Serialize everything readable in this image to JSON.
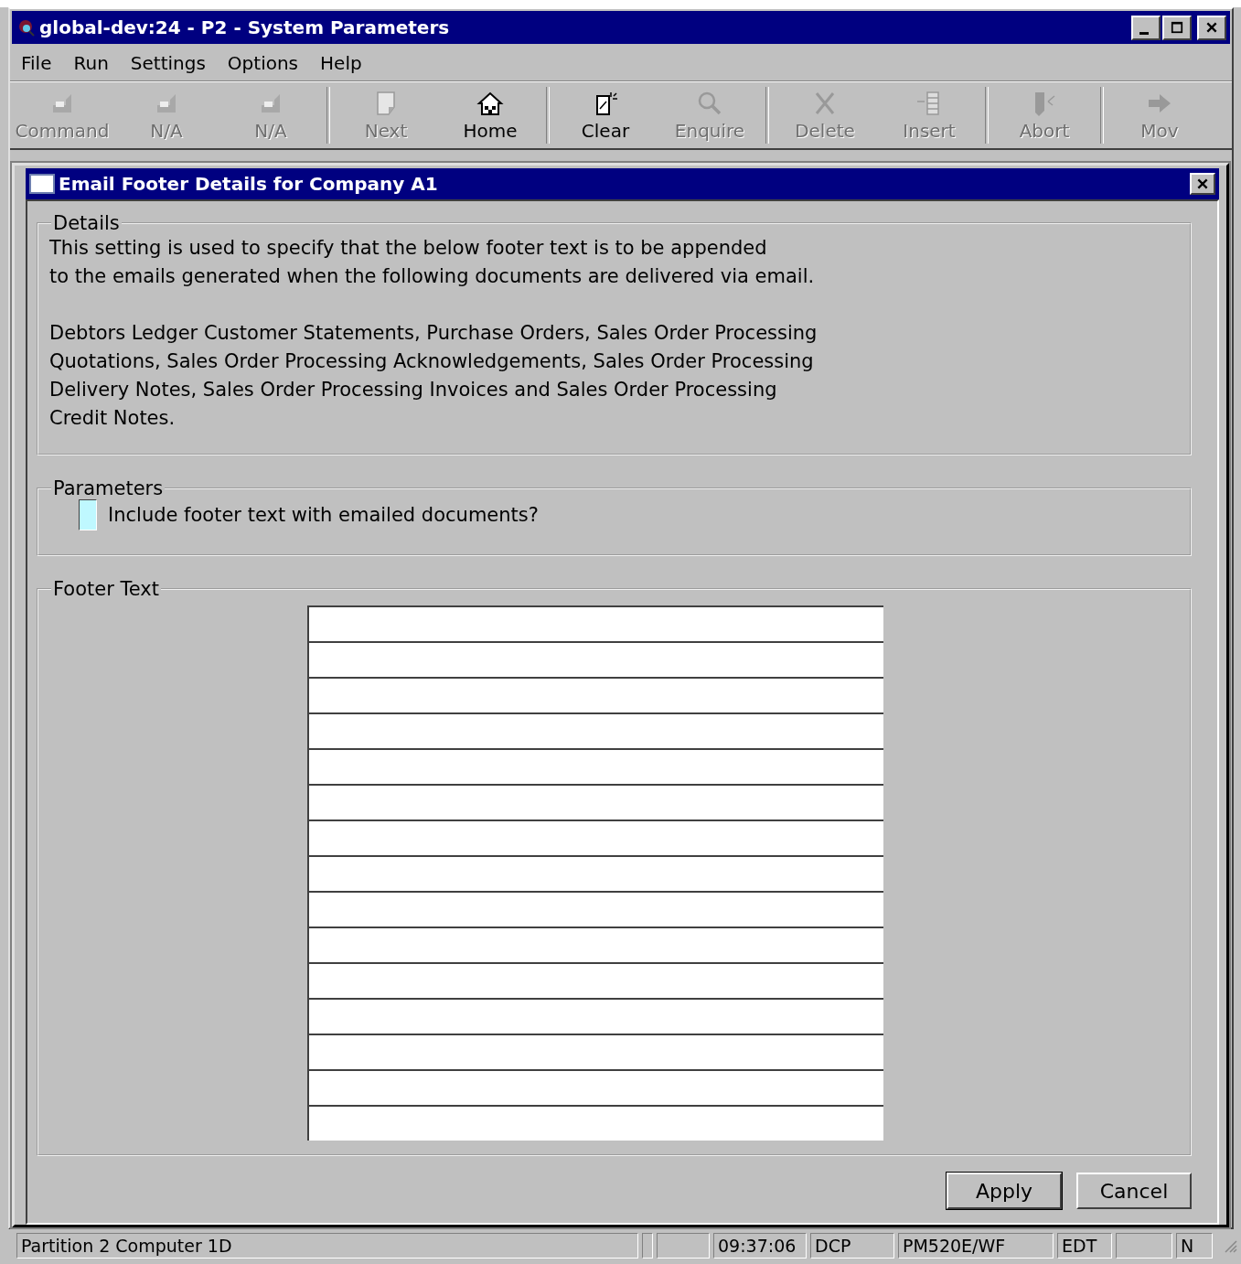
{
  "window": {
    "title": "global-dev:24 - P2 - System Parameters"
  },
  "menu": [
    {
      "label": "File"
    },
    {
      "label": "Run"
    },
    {
      "label": "Settings"
    },
    {
      "label": "Options"
    },
    {
      "label": "Help"
    }
  ],
  "toolbar": [
    [
      {
        "label": "Command",
        "kind": "f1",
        "disabled": true
      },
      {
        "label": "N/A",
        "kind": "f2",
        "disabled": true
      },
      {
        "label": "N/A",
        "kind": "f3",
        "disabled": true
      }
    ],
    [
      {
        "label": "Next",
        "kind": "next",
        "disabled": true
      },
      {
        "label": "Home",
        "kind": "home",
        "disabled": false
      }
    ],
    [
      {
        "label": "Clear",
        "kind": "clear",
        "disabled": false
      },
      {
        "label": "Enquire",
        "kind": "enquire",
        "disabled": true
      }
    ],
    [
      {
        "label": "Delete",
        "kind": "delete",
        "disabled": true
      },
      {
        "label": "Insert",
        "kind": "insert",
        "disabled": true
      }
    ],
    [
      {
        "label": "Abort",
        "kind": "abort",
        "disabled": true
      }
    ],
    [
      {
        "label": "Mov",
        "kind": "move",
        "disabled": true
      }
    ]
  ],
  "dialog": {
    "title": "Email Footer Details for Company A1",
    "details": {
      "legend": "Details",
      "paragraphs": [
        "This setting is used to specify that the below footer text is to be appended\nto the emails generated when the following documents are delivered via email.",
        "Debtors Ledger Customer Statements, Purchase Orders, Sales Order Processing\nQuotations, Sales Order Processing Acknowledgements, Sales Order Processing\nDelivery Notes, Sales Order Processing Invoices and Sales Order Processing\nCredit Notes."
      ]
    },
    "parameters": {
      "legend": "Parameters",
      "checkbox": {
        "label": "Include footer text with emailed documents?",
        "checked": false
      }
    },
    "footer_text": {
      "legend": "Footer Text",
      "lines": [
        {
          "kind": "text"
        },
        {
          "kind": "text"
        },
        {
          "kind": "text"
        },
        {
          "kind": "text"
        },
        {
          "kind": "text"
        },
        {
          "kind": "text"
        },
        {
          "kind": "text"
        },
        {
          "kind": "text"
        },
        {
          "kind": "text"
        },
        {
          "kind": "text"
        },
        {
          "kind": "text"
        },
        {
          "kind": "text"
        },
        {
          "kind": "text"
        },
        {
          "kind": "text"
        },
        {
          "kind": "text"
        }
      ]
    },
    "buttons": [
      {
        "label": "Apply",
        "default": true
      },
      {
        "label": "Cancel",
        "default": false
      }
    ]
  },
  "status_bar": [
    {
      "kind": "text",
      "text": "Partition 2 Computer 1D"
    },
    {
      "kind": "blank"
    },
    {
      "kind": "blank"
    },
    {
      "kind": "text",
      "text": "09:37:06"
    },
    {
      "kind": "text",
      "text": "DCP"
    },
    {
      "kind": "text",
      "text": "PM520E/WF"
    },
    {
      "kind": "text",
      "text": "EDT"
    },
    {
      "kind": "blank"
    },
    {
      "kind": "text",
      "text": "N"
    }
  ]
}
